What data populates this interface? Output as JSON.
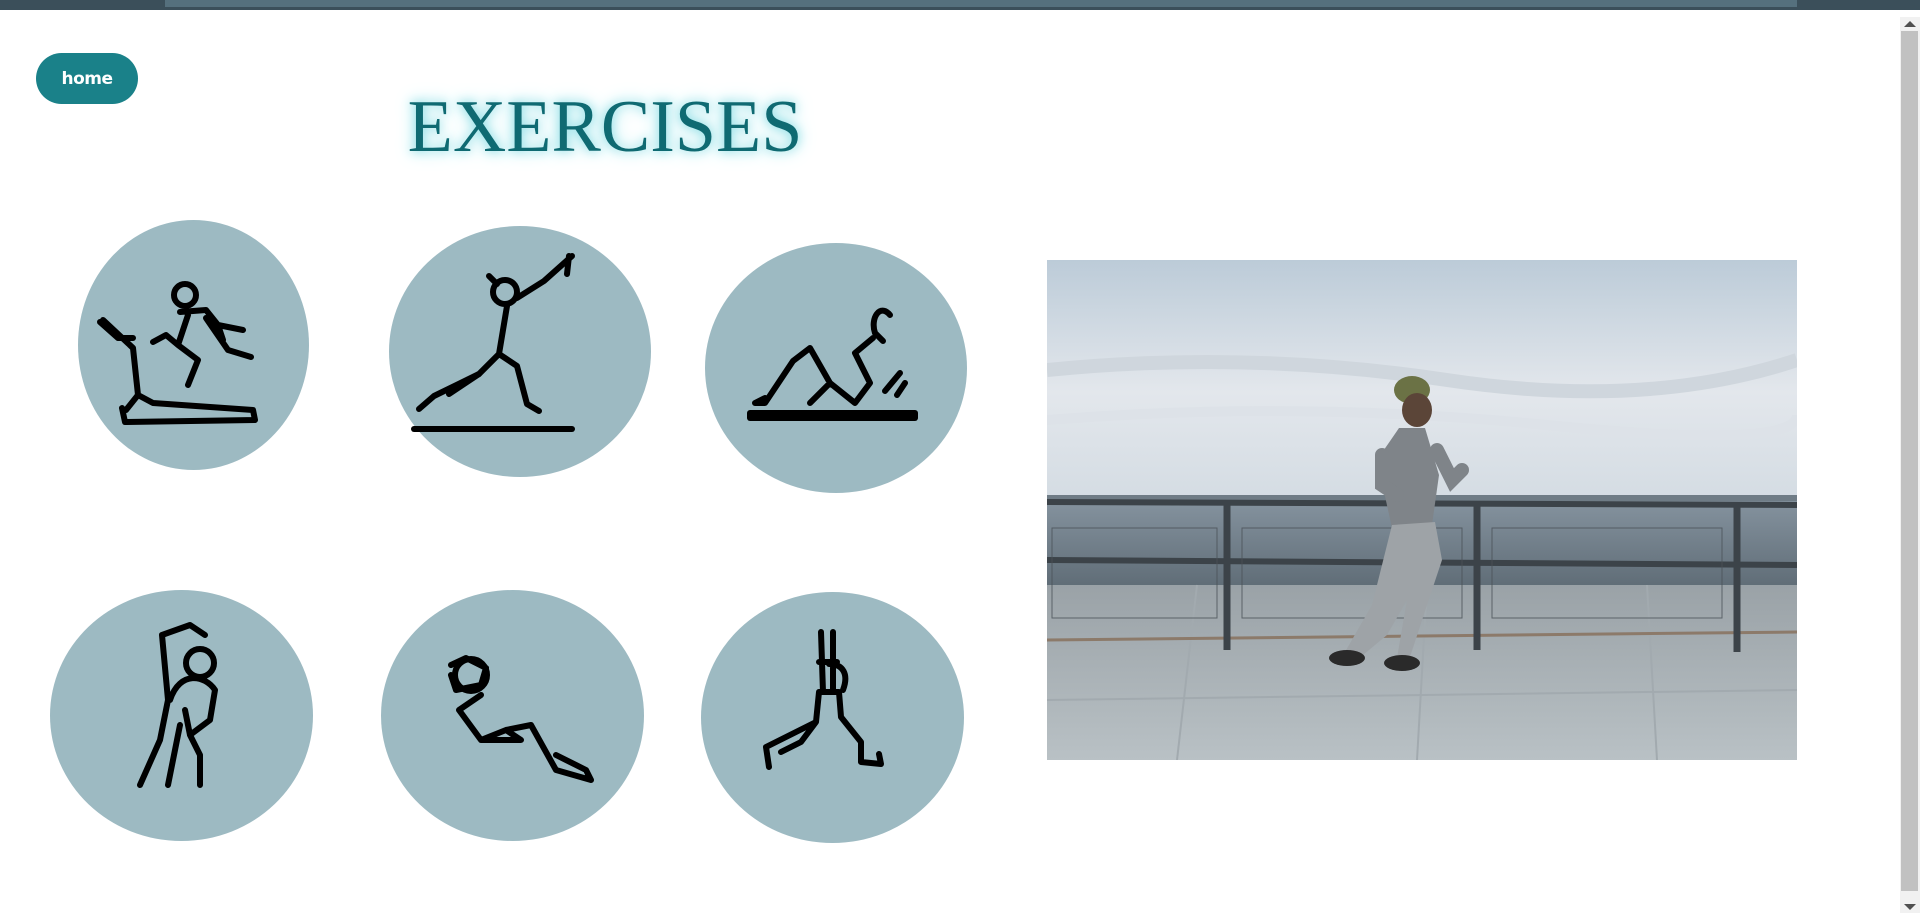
{
  "nav": {
    "home_label": "home"
  },
  "page": {
    "title": "EXERCISES"
  },
  "exercises": [
    {
      "icon": "treadmill-running-icon"
    },
    {
      "icon": "lunge-stretch-icon"
    },
    {
      "icon": "crunch-exercise-icon"
    },
    {
      "icon": "side-stretch-icon"
    },
    {
      "icon": "sit-up-icon"
    },
    {
      "icon": "warrior-pose-icon"
    }
  ],
  "colors": {
    "accent": "#1a8189",
    "title": "#0f6a72",
    "circle": "#9dbac2"
  },
  "hero_image": {
    "subject": "running-man-photo"
  }
}
